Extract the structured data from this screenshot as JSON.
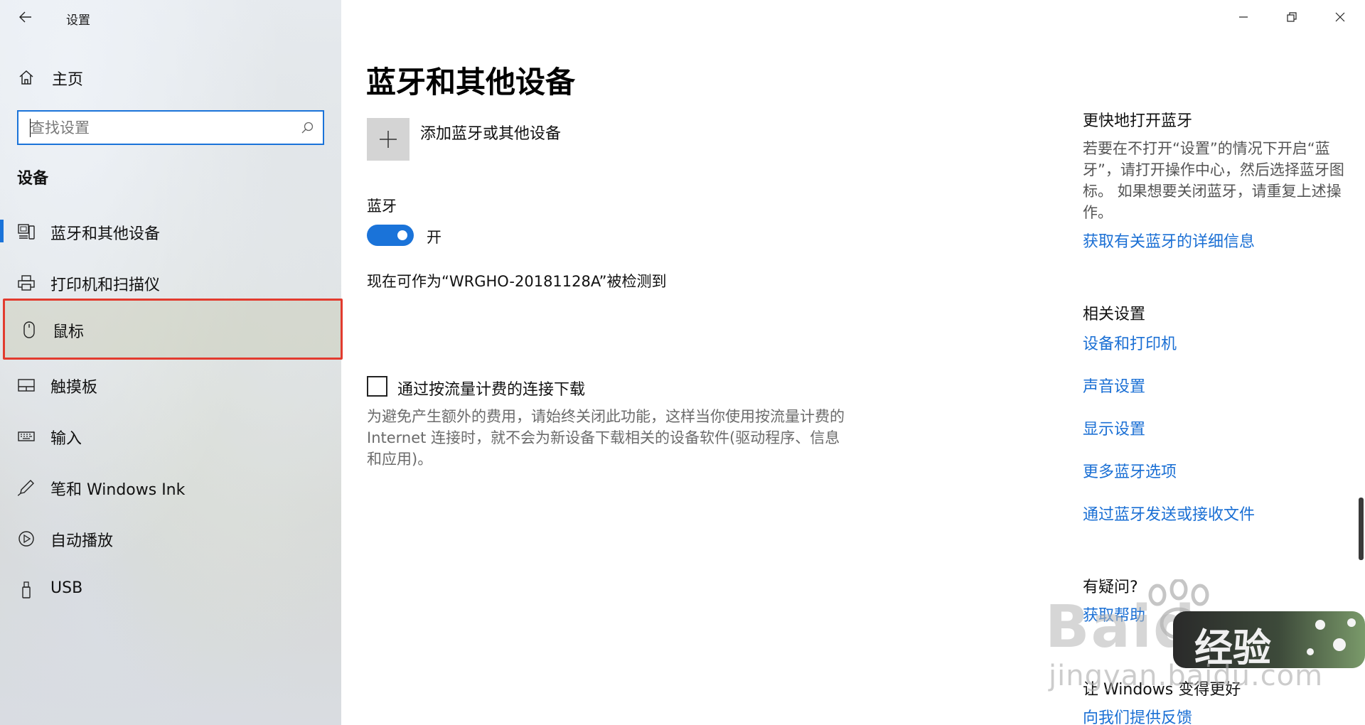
{
  "window": {
    "title": "设置",
    "controls": [
      "minimize-icon",
      "restore-icon",
      "close-icon"
    ]
  },
  "sidebar": {
    "home_label": "主页",
    "search_placeholder": "查找设置",
    "section_title": "设备",
    "items": [
      {
        "label": "蓝牙和其他设备",
        "icon": "bluetooth-devices-icon",
        "selected": true
      },
      {
        "label": "打印机和扫描仪",
        "icon": "printer-icon",
        "selected": false
      },
      {
        "label": "鼠标",
        "icon": "mouse-icon",
        "selected": false
      },
      {
        "label": "触摸板",
        "icon": "touchpad-icon",
        "selected": false
      },
      {
        "label": "输入",
        "icon": "keyboard-icon",
        "selected": false
      },
      {
        "label": "笔和 Windows Ink",
        "icon": "pen-icon",
        "selected": false
      },
      {
        "label": "自动播放",
        "icon": "autoplay-icon",
        "selected": false
      },
      {
        "label": "USB",
        "icon": "usb-icon",
        "selected": false
      }
    ]
  },
  "main": {
    "title": "蓝牙和其他设备",
    "add_device_label": "添加蓝牙或其他设备",
    "bluetooth_label": "蓝牙",
    "bluetooth_on": true,
    "bluetooth_state": "开",
    "discoverable_text": "现在可作为“WRGHO-20181128A”被检测到",
    "metered_checked": false,
    "metered_label": "通过按流量计费的连接下载",
    "metered_desc": "为避免产生额外的费用，请始终关闭此功能，这样当你使用按流量计费的 Internet 连接时，就不会为新设备下载相关的设备软件(驱动程序、信息和应用)。"
  },
  "rail": {
    "quick_title": "更快地打开蓝牙",
    "quick_desc": "若要在不打开“设置”的情况下开启“蓝牙”，请打开操作中心，然后选择蓝牙图标。 如果想要关闭蓝牙，请重复上述操作。",
    "quick_link": "获取有关蓝牙的详细信息",
    "related_title": "相关设置",
    "related_links": [
      "设备和打印机",
      "声音设置",
      "显示设置",
      "更多蓝牙选项",
      "通过蓝牙发送或接收文件"
    ],
    "help_title": "有疑问?",
    "help_link": "获取帮助",
    "better_title": "让 Windows 变得更好",
    "feedback_link": "向我们提供反馈"
  },
  "watermark": {
    "brand": "Baidu",
    "badge": "经验",
    "url": "jingyan.baidu.com"
  },
  "colors": {
    "accent": "#1a73d9",
    "link": "#1a6fd4",
    "highlight_border": "#e23b2e"
  }
}
